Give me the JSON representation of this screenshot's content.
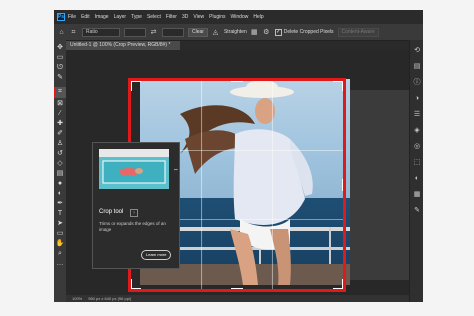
{
  "menubar": {
    "logo": "Ps",
    "items": [
      "File",
      "Edit",
      "Image",
      "Layer",
      "Type",
      "Select",
      "Filter",
      "3D",
      "View",
      "Plugins",
      "Window",
      "Help"
    ]
  },
  "options": {
    "ratio": "Ratio",
    "clear": "Clear",
    "straighten": "Straighten",
    "delete_cropped": "Delete Cropped Pixels",
    "content_aware": "Content-Aware"
  },
  "document": {
    "tab_title": "Untitled-1 @ 100% (Crop Preview, RGB/8#) *"
  },
  "status": {
    "zoom": "100%",
    "info": "960 px x 640 px (96 ppi)"
  },
  "tooltip": {
    "title": "Crop tool",
    "help": "?",
    "description": "Trims or expands the edges of an image",
    "button": "Learn more"
  },
  "colors": {
    "accent": "#e01a1a",
    "foreground_swatch": "#1fa0c9",
    "background_swatch": "#ffffff"
  }
}
